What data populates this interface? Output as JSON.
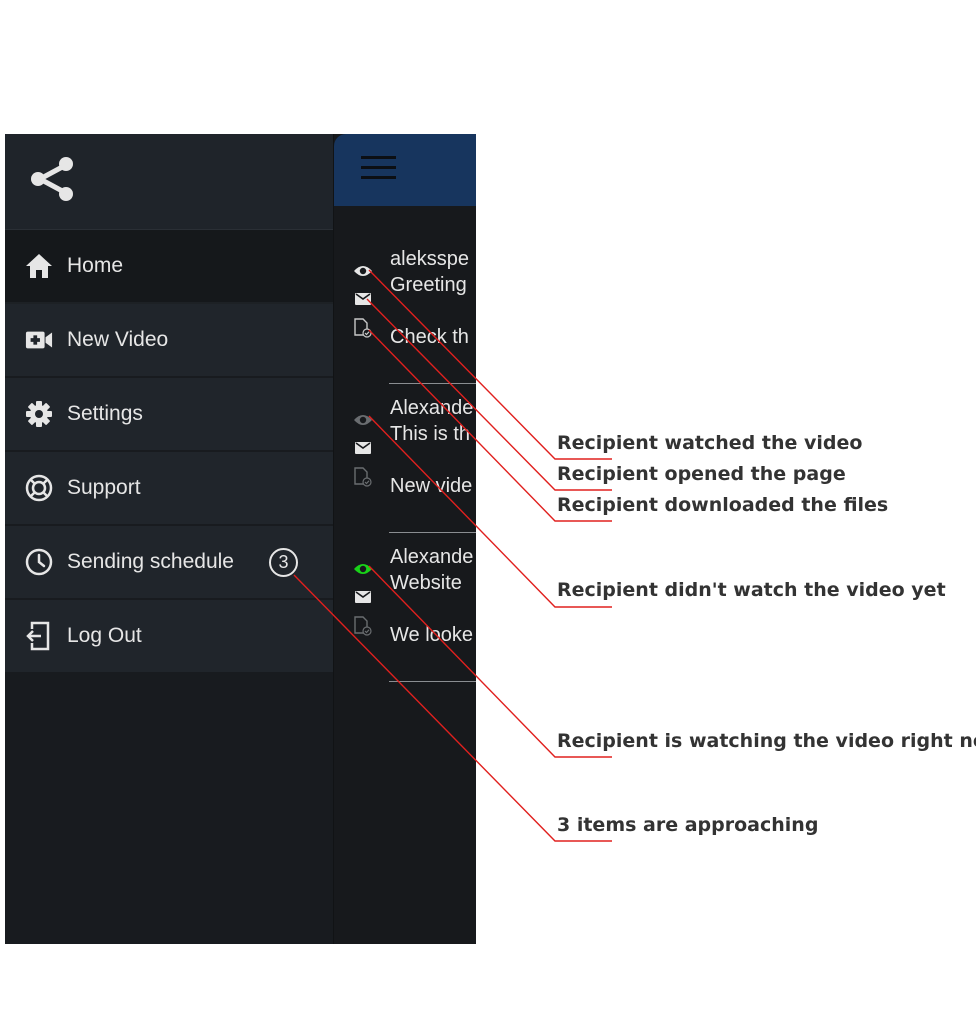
{
  "drawer": {
    "logo_icon": "share-icon",
    "items": [
      {
        "label": "Home",
        "icon": "home-icon"
      },
      {
        "label": "New Video",
        "icon": "video-camera-icon"
      },
      {
        "label": "Settings",
        "icon": "gear-icon"
      },
      {
        "label": "Support",
        "icon": "lifebuoy-icon"
      },
      {
        "label": "Sending schedule",
        "icon": "clock-icon",
        "badge": "3"
      },
      {
        "label": "Log Out",
        "icon": "logout-icon"
      }
    ]
  },
  "appbar": {
    "menu_icon": "hamburger-icon",
    "color": "#17355e"
  },
  "messages": [
    {
      "sender": "aleksspe",
      "subject": "Greeting",
      "preview": "Check th",
      "video_status": "watched"
    },
    {
      "sender": "Alexande",
      "subject": "This is th",
      "preview": "New vide",
      "video_status": "not-watched"
    },
    {
      "sender": "Alexande",
      "subject": "Website",
      "preview": "We looke",
      "video_status": "watching-now"
    }
  ],
  "colors": {
    "watching_now": "#19d219",
    "watched": "#e6e6e6",
    "not_watched": "#6a6d70",
    "callout_line": "#e0201e"
  },
  "annotations": [
    {
      "text": "Recipient watched the video"
    },
    {
      "text": "Recipient opened the page"
    },
    {
      "text": "Recipient downloaded the files"
    },
    {
      "text": "Recipient didn't watch the video yet"
    },
    {
      "text": "Recipient is watching the video right now"
    },
    {
      "text": "3 items are approaching"
    }
  ]
}
